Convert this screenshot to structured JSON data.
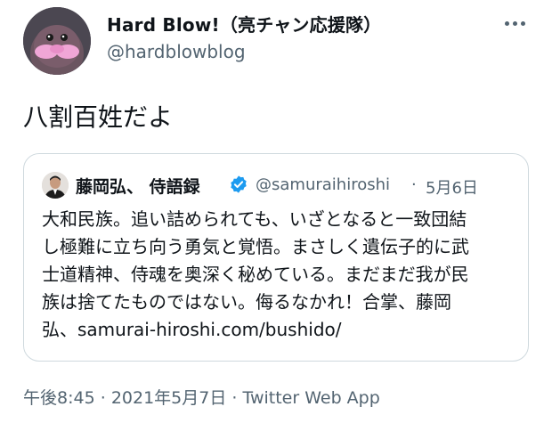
{
  "author": {
    "display_name": "Hard Blow!（亮チャン応援隊）",
    "handle": "@hardblowblog",
    "avatar_icon": "walrus-character-avatar"
  },
  "more_icon": "more-horizontal-icon",
  "tweet": {
    "text": "八割百姓だよ"
  },
  "quoted": {
    "name": "藤岡弘、 侍語録",
    "handle": "@samuraihiroshi",
    "separator": "·",
    "date": "5月6日",
    "verified_icon": "verified-badge-icon",
    "verified_color": "#1d9bf0",
    "lines": [
      "大和民族。追い詰められても、いざとなると一致団結",
      "し極難に立ち向う勇気と覚悟。まさしく遺伝子的に武",
      "士道精神、侍魂を奥深く秘めている。まだまだ我が民",
      "族は捨てたものではない。侮るなかれ！合掌、藤岡",
      "弘、samurai-hiroshi.com/bushido/"
    ]
  },
  "meta": {
    "time": "午後8:45",
    "sep1": "·",
    "date": "2021年5月7日",
    "sep2": "·",
    "source": "Twitter Web App"
  }
}
